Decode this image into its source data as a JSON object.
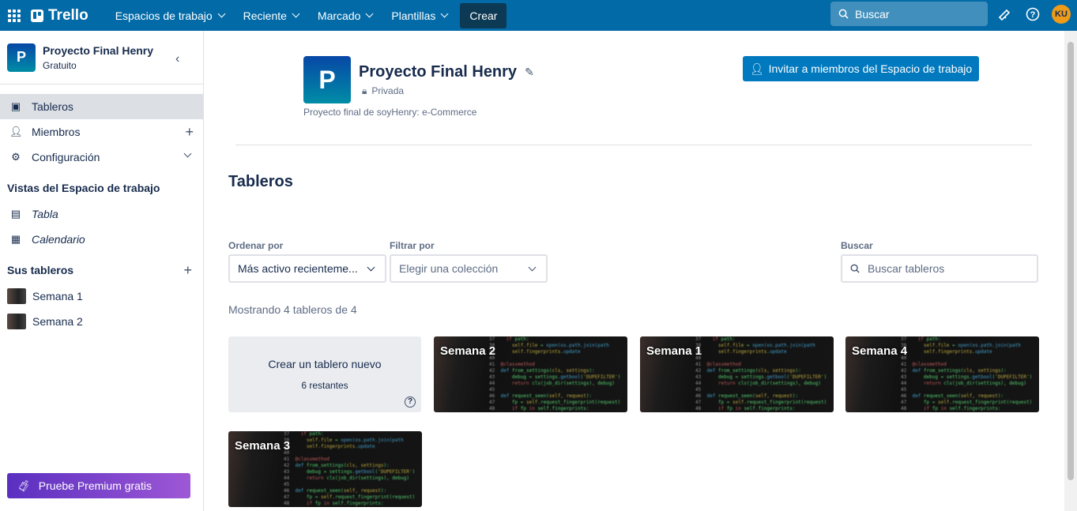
{
  "topbar": {
    "brand": "Trello",
    "nav": [
      "Espacios de trabajo",
      "Reciente",
      "Marcado",
      "Plantillas"
    ],
    "create": "Crear",
    "search_placeholder": "Buscar",
    "avatar": "KU"
  },
  "sidebar": {
    "workspace_name": "Proyecto Final Henry",
    "workspace_plan": "Gratuito",
    "workspace_initial": "P",
    "items": [
      {
        "label": "Tableros"
      },
      {
        "label": "Miembros"
      },
      {
        "label": "Configuración"
      }
    ],
    "views_heading": "Vistas del Espacio de trabajo",
    "views": [
      {
        "label": "Tabla"
      },
      {
        "label": "Calendario"
      }
    ],
    "boards_heading": "Sus tableros",
    "boards": [
      {
        "label": "Semana 1"
      },
      {
        "label": "Semana 2"
      }
    ],
    "premium": "Pruebe Premium gratis"
  },
  "header": {
    "initial": "P",
    "title": "Proyecto Final Henry",
    "visibility": "Privada",
    "description": "Proyecto final de soyHenry: e-Commerce",
    "invite": "Invitar a miembros del Espacio de trabajo"
  },
  "boards_section": {
    "title": "Tableros",
    "sort_label": "Ordenar por",
    "sort_value": "Más activo recienteme...",
    "filter_label": "Filtrar por",
    "filter_value": "Elegir una colección",
    "search_label": "Buscar",
    "search_placeholder": "Buscar tableros",
    "count": "Mostrando 4 tableros de 4",
    "create": {
      "label": "Crear un tablero nuevo",
      "remaining": "6 restantes"
    },
    "boards": [
      {
        "name": "Semana 2"
      },
      {
        "name": "Semana 1"
      },
      {
        "name": "Semana 4"
      },
      {
        "name": "Semana 3"
      }
    ]
  }
}
